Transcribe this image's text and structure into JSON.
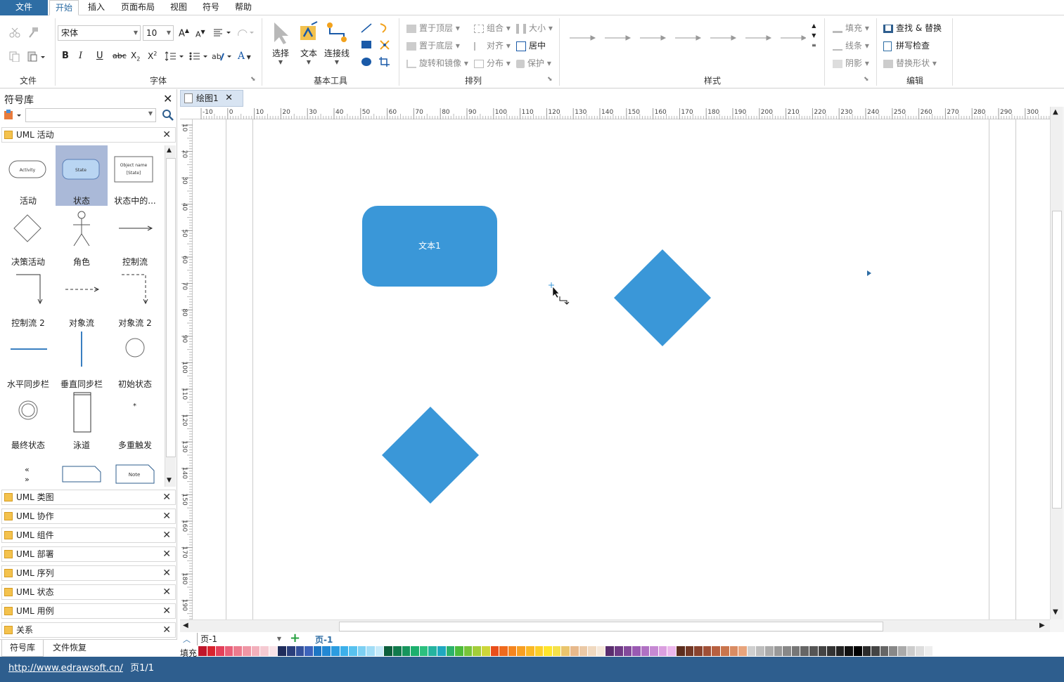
{
  "menu": {
    "tabs": [
      "文件",
      "开始",
      "插入",
      "页面布局",
      "视图",
      "符号",
      "帮助"
    ],
    "active": "开始"
  },
  "ribbon": {
    "file_group": {
      "label": "文件"
    },
    "font_group": {
      "label": "字体",
      "font_name": "宋体",
      "font_size": "10"
    },
    "tools_group": {
      "label": "基本工具",
      "select": "选择",
      "text": "文本",
      "connector": "连接线"
    },
    "arrange_group": {
      "label": "排列",
      "bring_front": "置于顶层",
      "send_back": "置于底层",
      "rotate": "旋转和镜像",
      "group": "组合",
      "align": "对齐",
      "distribute": "分布",
      "size": "大小",
      "center": "居中",
      "protect": "保护"
    },
    "style_group": {
      "label": "样式"
    },
    "fill_group": {
      "fill": "填充",
      "line": "线条",
      "shadow": "阴影"
    },
    "edit_group": {
      "label": "编辑",
      "find_replace": "查找 & 替换",
      "spell_check": "拼写检查",
      "replace_shape": "替换形状"
    }
  },
  "sidebar": {
    "title": "符号库",
    "open_library": "UML 活动",
    "shapes": [
      {
        "label": "活动",
        "inner": "Activity"
      },
      {
        "label": "状态",
        "inner": "State"
      },
      {
        "label": "状态中的...",
        "inner": "Object name [State]"
      },
      {
        "label": "决策活动"
      },
      {
        "label": "角色"
      },
      {
        "label": "控制流"
      },
      {
        "label": "控制流 2"
      },
      {
        "label": "对象流"
      },
      {
        "label": "对象流 2"
      },
      {
        "label": "水平同步栏"
      },
      {
        "label": "垂直同步栏"
      },
      {
        "label": "初始状态"
      },
      {
        "label": "最终状态"
      },
      {
        "label": "泳道"
      },
      {
        "label": "多重触发"
      }
    ],
    "partial_row": {
      "note": "Note"
    },
    "libraries": [
      "UML 类图",
      "UML 协作",
      "UML 组件",
      "UML 部署",
      "UML 序列",
      "UML 状态",
      "UML 用例",
      "关系"
    ],
    "bottom_tabs": [
      "符号库",
      "文件恢复"
    ]
  },
  "document": {
    "tab_title": "绘图1",
    "shape_text": "文本1",
    "ruler_h": [
      "-10",
      "0",
      "10",
      "20",
      "30",
      "40",
      "50",
      "60",
      "70",
      "80",
      "90",
      "100",
      "110",
      "120",
      "130",
      "140",
      "150",
      "160",
      "170",
      "180",
      "190",
      "200",
      "210",
      "220",
      "230",
      "240",
      "250",
      "260",
      "270",
      "280",
      "290",
      "300"
    ],
    "ruler_v": [
      "10",
      "20",
      "30",
      "40",
      "50",
      "60",
      "70",
      "80",
      "90",
      "100",
      "110",
      "120",
      "130",
      "140",
      "150",
      "160",
      "170",
      "180",
      "190"
    ]
  },
  "pagebar": {
    "page_select": "页-1",
    "page_tab": "页-1",
    "fill_label": "填充"
  },
  "status": {
    "url": "http://www.edrawsoft.cn/",
    "page_info": "页1/1"
  },
  "colors": {
    "shape_blue": "#3a97d8",
    "status_bar": "#2e5e8e",
    "accent": "#2e6da4"
  }
}
